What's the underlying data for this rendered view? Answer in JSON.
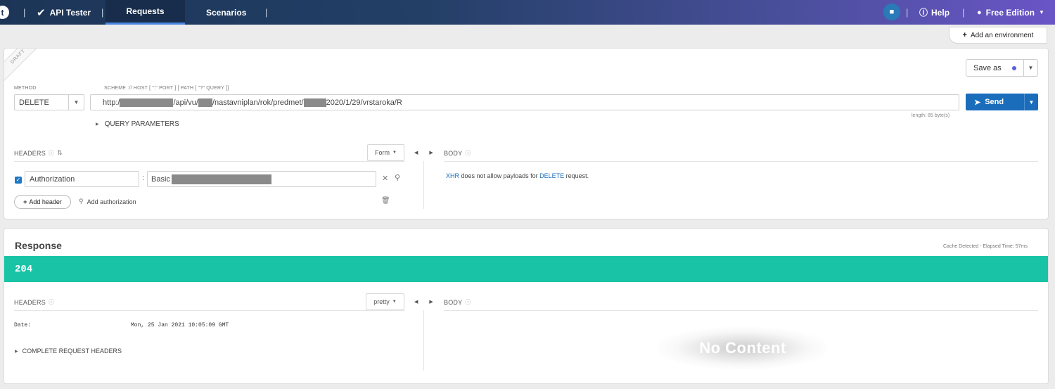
{
  "topbar": {
    "logo_letter": "t",
    "app_name": "API Tester",
    "tabs": [
      {
        "label": "Requests"
      },
      {
        "label": "Scenarios"
      }
    ],
    "help_label": "Help",
    "edition_label": "Free Edition",
    "gradient_colors": [
      "#1c3557",
      "#6a55c6"
    ],
    "icons": {
      "check": "check-circle-icon",
      "chat": "chat-icon",
      "help": "help-circle-icon",
      "user": "user-icon"
    }
  },
  "env_button": {
    "label": "Add an environment"
  },
  "request": {
    "draft_label": "DRAFT",
    "method_label": "METHOD",
    "method_value": "DELETE",
    "url_label": "SCHEME :// HOST [ \":\" PORT ] [ PATH [ \"?\" QUERY ]]",
    "url_parts": [
      "http:/",
      "/api/vu/",
      "/nastavniplan/rok/predmet/",
      "2020/1/29/vrstaroka/R"
    ],
    "length_label": "length: 85 byte(s)",
    "save_as_label": "Save as",
    "send_label": "Send",
    "query_params_label": "QUERY PARAMETERS",
    "headers_label": "HEADERS",
    "form_label": "Form",
    "body_label": "BODY",
    "header_row": {
      "name": "Authorization",
      "value_prefix": "Basic"
    },
    "add_header_label": "Add header",
    "add_auth_label": "Add authorization",
    "body_message": {
      "xhr": "XHR",
      "middle": "does not allow payloads for",
      "method": "DELETE",
      "end": "request."
    },
    "accent_color": "#1a6dbb"
  },
  "response": {
    "title": "Response",
    "cache_info": "Cache Detected - Elapsed Time: 57ms",
    "status_code": "204",
    "status_color": "#19c4a6",
    "headers_label": "HEADERS",
    "pretty_label": "pretty",
    "body_label": "BODY",
    "headers": [
      {
        "key": "Date:",
        "value": "Mon, 25 Jan 2021 10:05:09 GMT"
      }
    ],
    "complete_headers_label": "COMPLETE REQUEST HEADERS",
    "no_content_label": "No Content"
  }
}
